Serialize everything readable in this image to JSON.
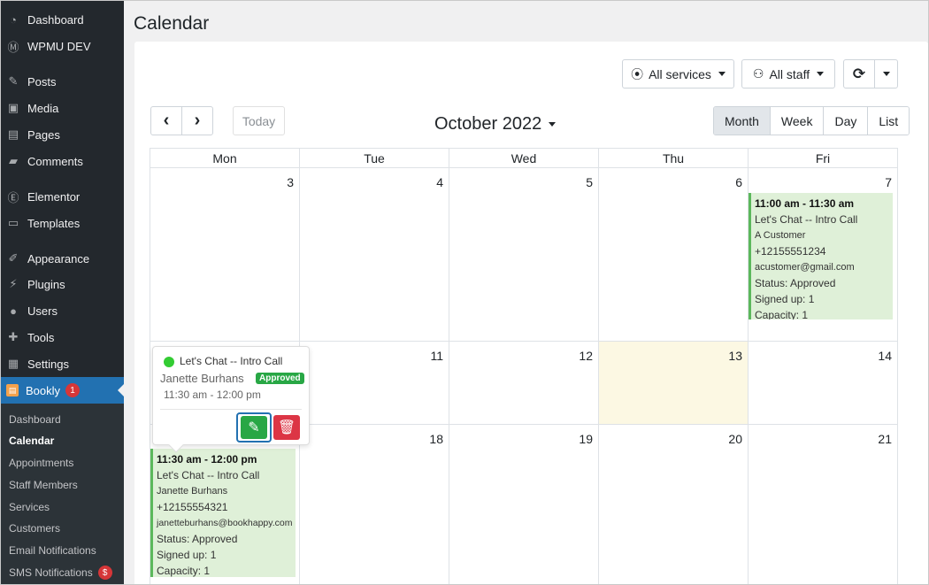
{
  "sidebar": {
    "items": [
      {
        "label": "Dashboard",
        "icon": "dashboard-icon"
      },
      {
        "label": "WPMU DEV",
        "icon": "wpmudev-icon"
      },
      {
        "label": "Posts",
        "icon": "pin-icon"
      },
      {
        "label": "Media",
        "icon": "media-icon"
      },
      {
        "label": "Pages",
        "icon": "pages-icon"
      },
      {
        "label": "Comments",
        "icon": "comment-icon"
      },
      {
        "label": "Elementor",
        "icon": "elementor-icon"
      },
      {
        "label": "Templates",
        "icon": "folder-icon"
      },
      {
        "label": "Appearance",
        "icon": "brush-icon"
      },
      {
        "label": "Plugins",
        "icon": "plug-icon"
      },
      {
        "label": "Users",
        "icon": "user-icon"
      },
      {
        "label": "Tools",
        "icon": "wrench-icon"
      },
      {
        "label": "Settings",
        "icon": "settings-icon"
      },
      {
        "label": "Bookly",
        "icon": "bookly-icon",
        "badge": "1"
      }
    ],
    "submenu": [
      {
        "label": "Dashboard"
      },
      {
        "label": "Calendar"
      },
      {
        "label": "Appointments"
      },
      {
        "label": "Staff Members"
      },
      {
        "label": "Services"
      },
      {
        "label": "Customers"
      },
      {
        "label": "Email Notifications"
      },
      {
        "label": "SMS Notifications",
        "badge": "$"
      }
    ]
  },
  "page": {
    "title": "Calendar"
  },
  "filters": {
    "services": "All services",
    "staff": "All staff"
  },
  "nav": {
    "prev": "‹",
    "next": "›",
    "today": "Today"
  },
  "month_label": "October 2022",
  "views": [
    "Month",
    "Week",
    "Day",
    "List"
  ],
  "active_view": "Month",
  "weekdays": [
    "Mon",
    "Tue",
    "Wed",
    "Thu",
    "Fri"
  ],
  "weeks": [
    [
      "3",
      "4",
      "5",
      "6",
      "7"
    ],
    [
      "",
      "11",
      "12",
      "13",
      "14"
    ],
    [
      "",
      "18",
      "19",
      "20",
      "21"
    ]
  ],
  "today": "13",
  "events": {
    "fri7": {
      "time": "11:00 am - 11:30 am",
      "service": "Let's Chat -- Intro Call",
      "customer": "A Customer",
      "phone": "+12155551234",
      "email": "acustomer@gmail.com",
      "status": "Status: Approved",
      "signed": "Signed up: 1",
      "capacity": "Capacity: 1"
    },
    "mon17": {
      "time": "11:30 am - 12:00 pm",
      "service": "Let's Chat -- Intro Call",
      "customer": "Janette Burhans",
      "phone": "+12155554321",
      "email": "janetteburhans@bookhappy.com",
      "status": "Status: Approved",
      "signed": "Signed up: 1",
      "capacity": "Capacity: 1"
    }
  },
  "popover": {
    "service": "Let's Chat -- Intro Call",
    "customer": "Janette Burhans",
    "status": "Approved",
    "time": "11:30 am - 12:00 pm",
    "dot_color": "#33cc33"
  },
  "colors": {
    "accent": "#2271b1",
    "event_bg": "#dff0d8",
    "today_bg": "#fcf8e3",
    "edit": "#28a745",
    "delete": "#dc3545"
  }
}
